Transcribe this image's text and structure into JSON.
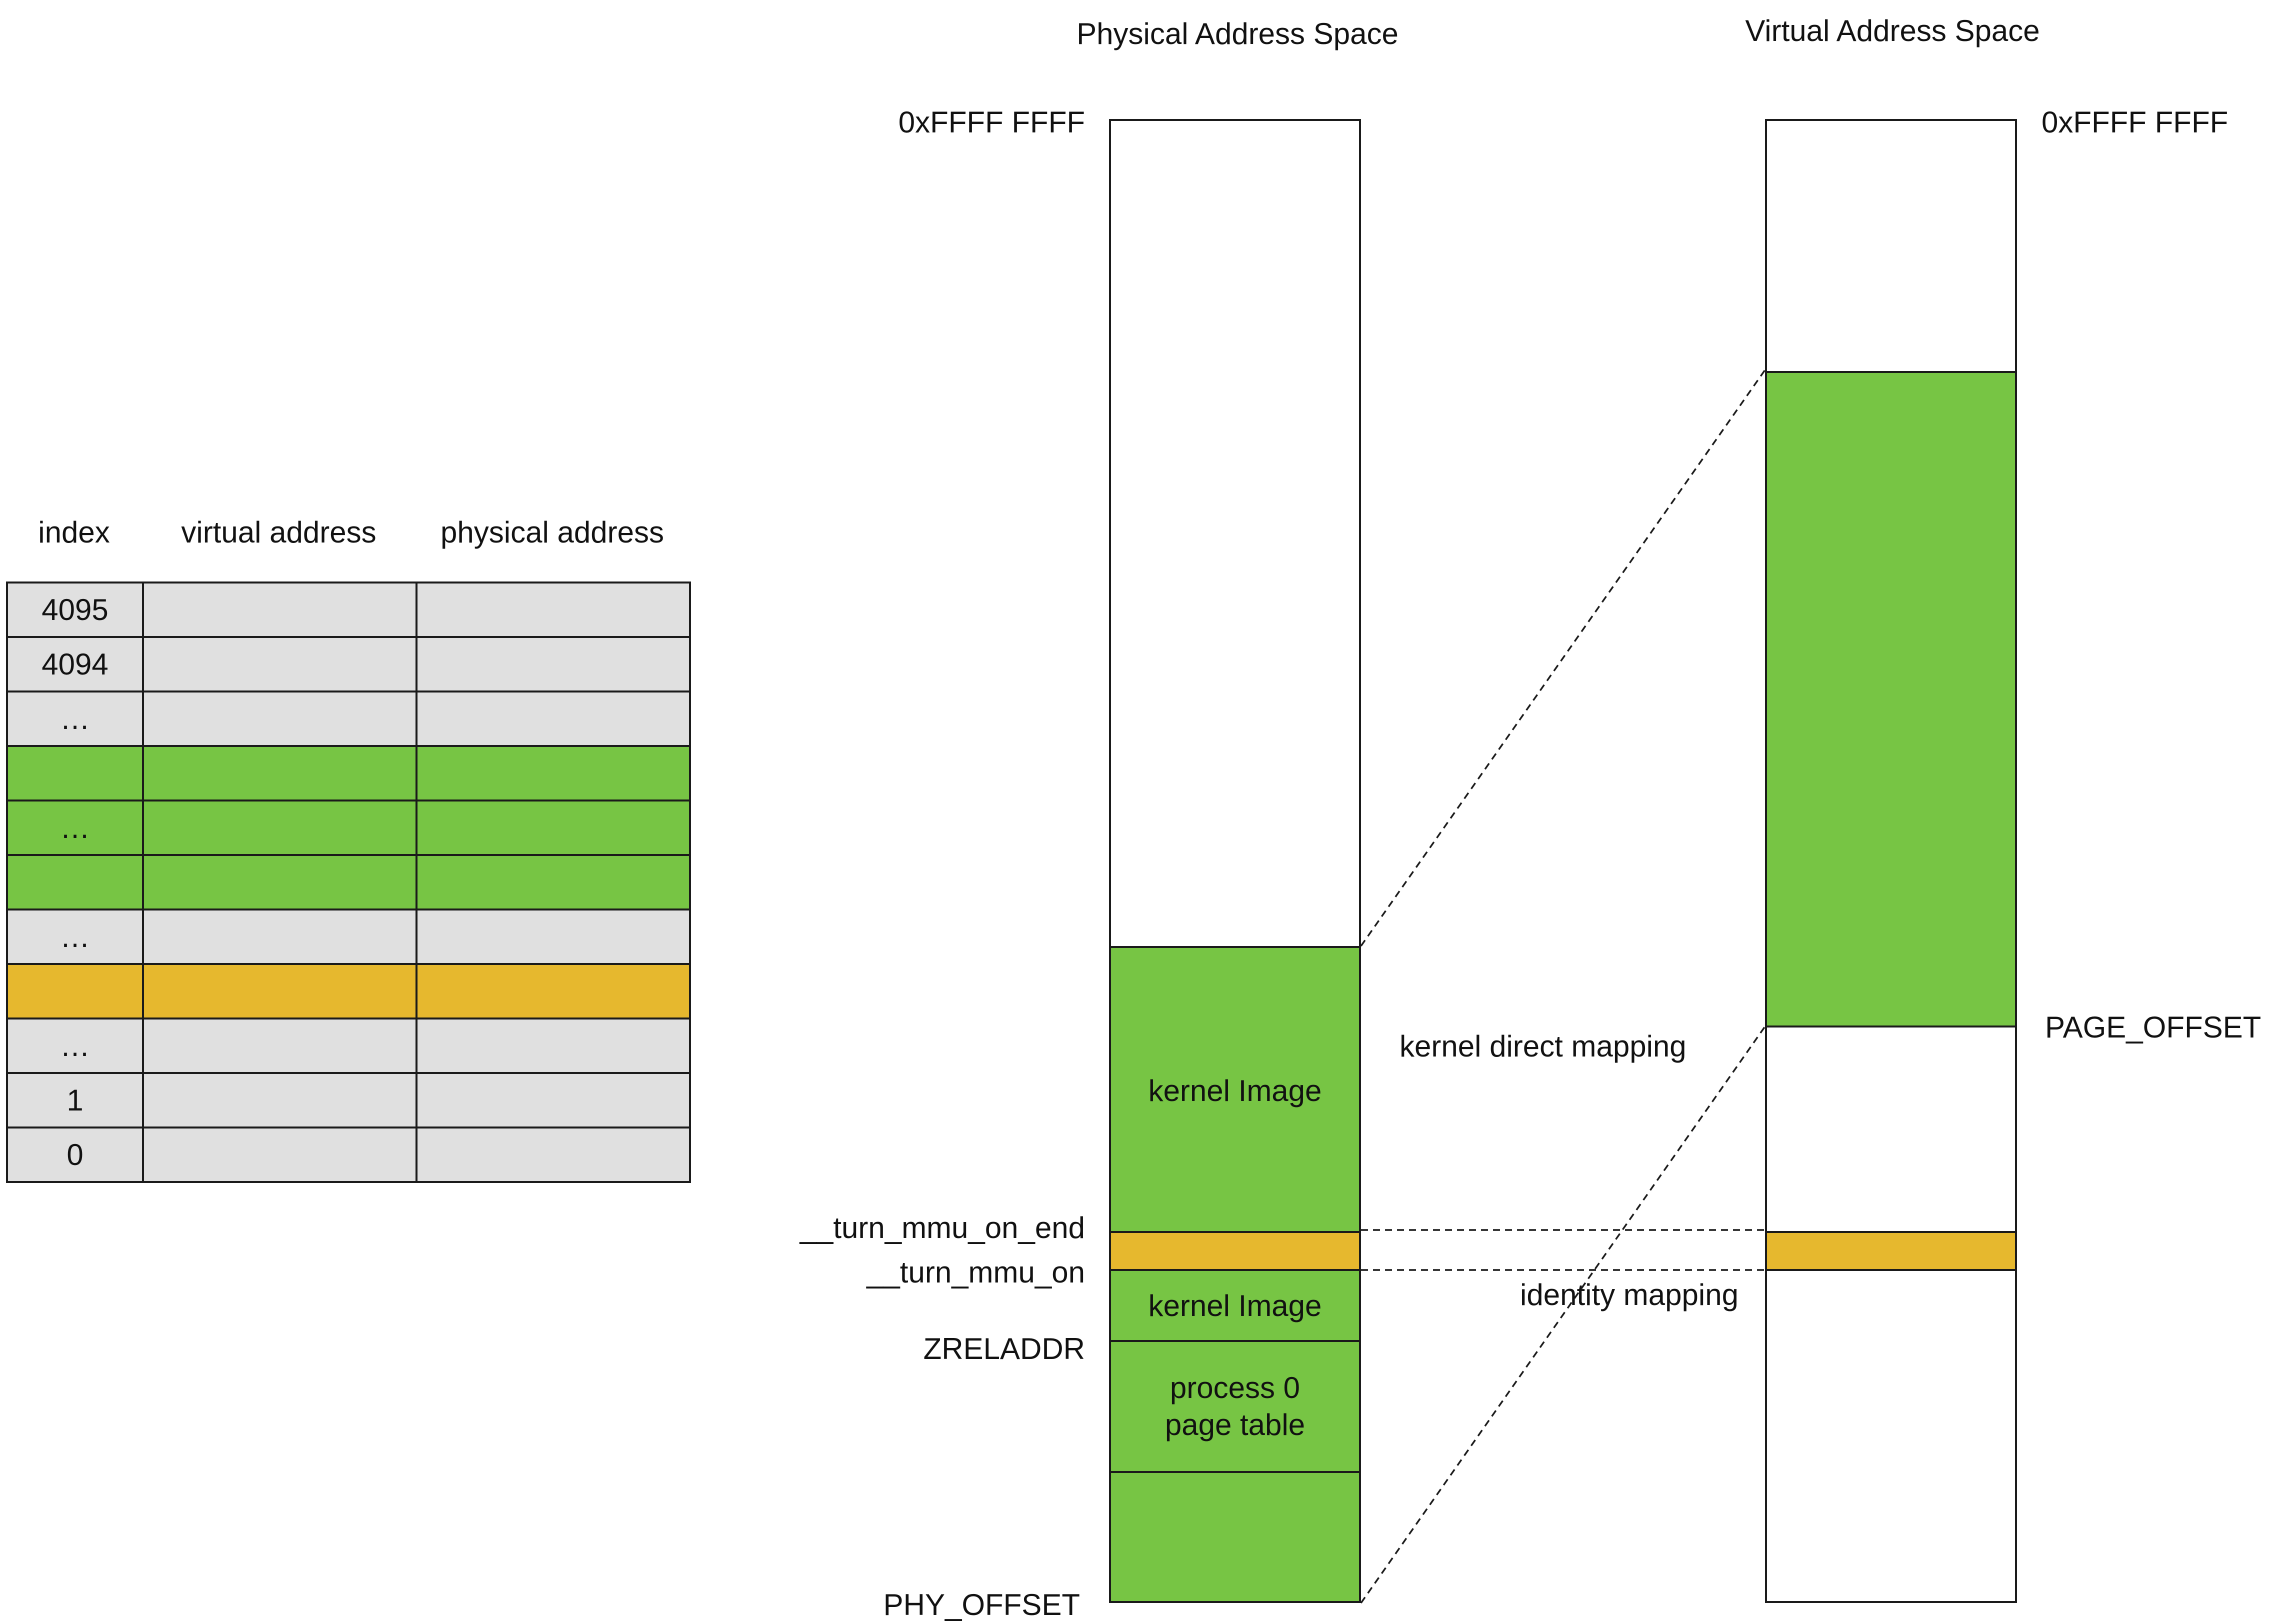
{
  "colors": {
    "green": "#77c544",
    "yellow": "#e6b82e",
    "gray": "#e0e0e0",
    "white": "#ffffff",
    "border": "#1a1a1a"
  },
  "page_table": {
    "headers": [
      "index",
      "virtual address",
      "physical address"
    ],
    "rows": [
      {
        "index": "4095",
        "color": "gray"
      },
      {
        "index": "4094",
        "color": "gray"
      },
      {
        "index": "…",
        "color": "gray"
      },
      {
        "index": "",
        "color": "green"
      },
      {
        "index": "…",
        "color": "green"
      },
      {
        "index": "",
        "color": "green"
      },
      {
        "index": "…",
        "color": "gray"
      },
      {
        "index": "",
        "color": "yellow"
      },
      {
        "index": "…",
        "color": "gray"
      },
      {
        "index": "1",
        "color": "gray"
      },
      {
        "index": "0",
        "color": "gray"
      }
    ]
  },
  "physical": {
    "title": "Physical Address Space",
    "top_label": "0xFFFF FFFF",
    "labels": {
      "turn_mmu_on_end": "__turn_mmu_on_end",
      "turn_mmu_on": "__turn_mmu_on",
      "zreladdr": "ZRELADDR",
      "phy_offset": "PHY_OFFSET"
    },
    "segments": {
      "kernel_image_upper": "kernel Image",
      "kernel_image_lower": "kernel Image",
      "process0_line1": "process 0",
      "process0_line2": "page table"
    }
  },
  "virtual": {
    "title": "Virtual Address Space",
    "top_label": "0xFFFF FFFF",
    "page_offset": "PAGE_OFFSET"
  },
  "mappings": {
    "kernel_direct": "kernel direct mapping",
    "identity": "identity mapping"
  }
}
